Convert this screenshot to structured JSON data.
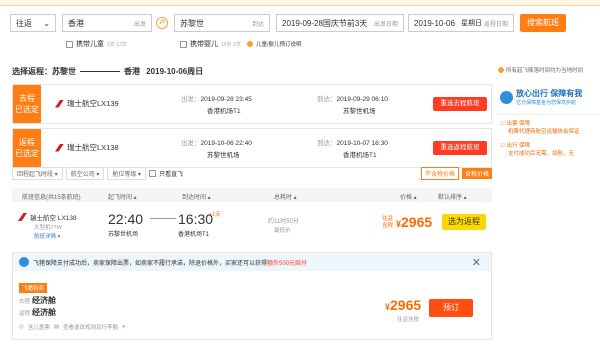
{
  "search": {
    "trip_type": "往返",
    "from_city": "香港",
    "from_hint": "出发",
    "to_city": "苏黎世",
    "to_hint": "到达",
    "depart_date": "2019-09-28",
    "depart_note": "国庆节前3天",
    "depart_hint": "出发日期",
    "return_date": "2019-10-06",
    "return_weekday": "星期日",
    "return_hint": "返程日期",
    "search_button": "搜索航班",
    "child_label": "携带儿童",
    "child_hint": "2岁-12岁",
    "infant_label": "携带婴儿",
    "infant_hint": "14天-2岁",
    "policy_link": "儿童/婴儿预订说明"
  },
  "header": {
    "select_label": "选择返程：",
    "from": "苏黎世",
    "to": "香港",
    "date": "2019-10-06周日",
    "right_info": "所有起飞降落时间均为当地时间"
  },
  "outbound": {
    "tag_line1": "去程",
    "tag_line2": "已选定",
    "airline": "瑞士航空LX139",
    "depart_label": "出发：",
    "depart_time": "2019-09-28 23:45",
    "depart_airport": "香港机场T1",
    "arrive_label": "到达：",
    "arrive_time": "2019-09-29 06:10",
    "arrive_airport": "苏黎世机场",
    "reselect": "重选去程航班"
  },
  "inbound": {
    "tag_line1": "返程",
    "tag_line2": "已选定",
    "airline": "瑞士航空LX138",
    "depart_label": "出发：",
    "depart_time": "2019-10-06 22:40",
    "depart_airport": "苏黎世机场",
    "arrive_label": "到达：",
    "arrive_time": "2019-10-07 16:30",
    "arrive_airport": "香港机场T1",
    "reselect": "重选返程航班"
  },
  "sidebar": {
    "title": "放心出行 保障有我",
    "subtitle": "亿元保障基金为您保驾护航",
    "item1_title": "出票 保障",
    "item1_desc": "机票代理商航空运输协会保证",
    "item2_title": "出行 保障",
    "item2_desc": "支付成功后无需，如航，无"
  },
  "filters": {
    "items": [
      "回程起飞时段 ▾",
      "航空公司 ▾",
      "舱位等级 ▾"
    ],
    "shared_label": "只看直飞",
    "tax_exclusive": "不含税价格",
    "tax_inclusive": "含税价格"
  },
  "columns": {
    "flight_info": "航班信息(共15条航班)",
    "depart_time": "起飞时间 ▴",
    "arrive_time": "到达时间 ▴",
    "duration": "总耗时 ▴",
    "price": "价格 ▴",
    "sort": "默认排序 ▴"
  },
  "row": {
    "airline": "瑞士航空 LX138",
    "aircraft": "大型机77W",
    "detail_link": "航班详情 ▾",
    "depart_time": "22:40",
    "depart_airport": "苏黎世机场",
    "arrive_time": "16:30",
    "arrive_plus": "+1天",
    "arrive_airport": "香港机场T1",
    "duration": "约11时50分",
    "duration_note": "最低价",
    "price_label_top": "往返",
    "price_label_bottom": "含税",
    "price_symbol": "¥",
    "price": "2965",
    "select_button": "选为返程"
  },
  "popup": {
    "banner": "飞猪保障支付成功后，卖家保障出票，如卖家不履行承诺，除退价格外，买家还可以获得",
    "banner_highlight": "额外500元赔付",
    "badge": "飞猪特卖",
    "outbound_label": "去程",
    "outbound_class": "经济舱",
    "inbound_label": "返程",
    "inbound_class": "经济舱",
    "note1": "含儿童票",
    "note2": "查看退改规则及行李额",
    "price_symbol": "¥",
    "price": "2965",
    "price_note": "往返含税",
    "book_button": "预订"
  }
}
